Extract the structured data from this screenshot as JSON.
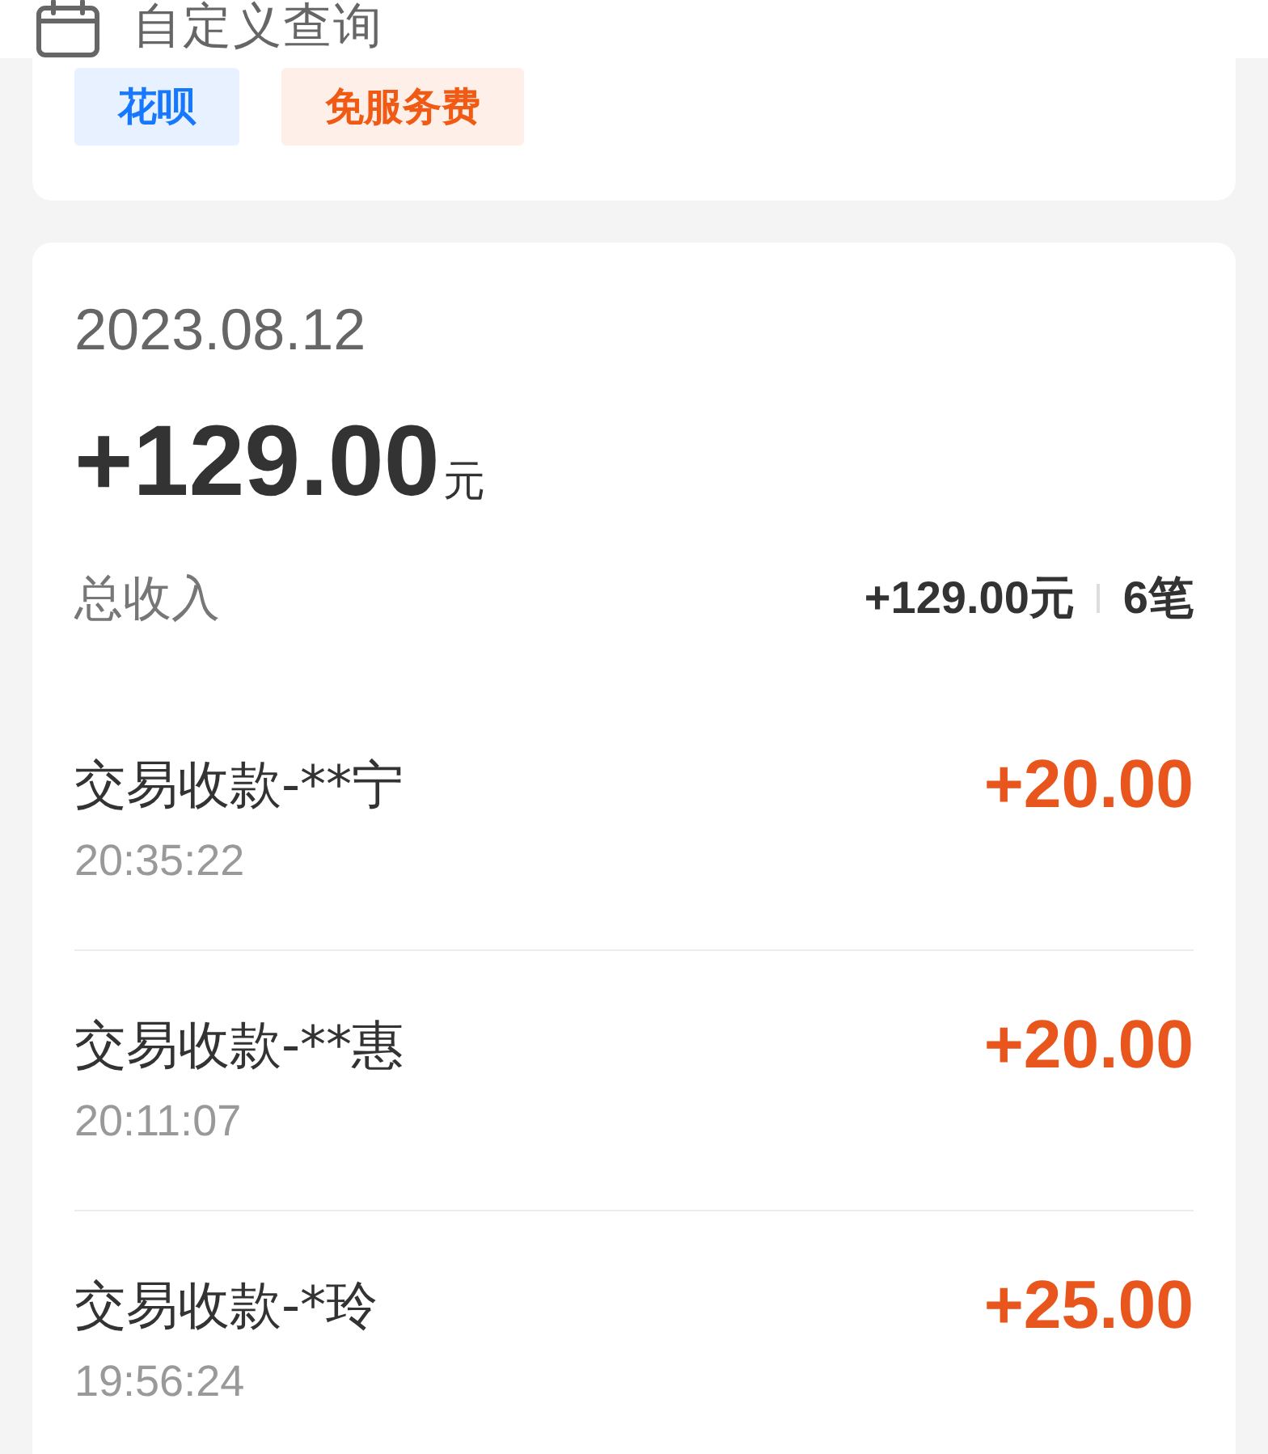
{
  "header": {
    "title": "自定义查询"
  },
  "filter_tags": [
    {
      "label": "花呗",
      "color": "#1677ff"
    },
    {
      "label": "免服务费",
      "color": "#f05a14"
    }
  ],
  "summary": {
    "date": "2023.08.12",
    "total": "+129.00",
    "unit": "元",
    "label": "总收入",
    "income": "+129.00元",
    "count": "6笔"
  },
  "transactions": [
    {
      "title": "交易收款-**宁",
      "time": "20:35:22",
      "amount": "+20.00"
    },
    {
      "title": "交易收款-**惠",
      "time": "20:11:07",
      "amount": "+20.00"
    },
    {
      "title": "交易收款-*玲",
      "time": "19:56:24",
      "amount": "+25.00"
    }
  ]
}
